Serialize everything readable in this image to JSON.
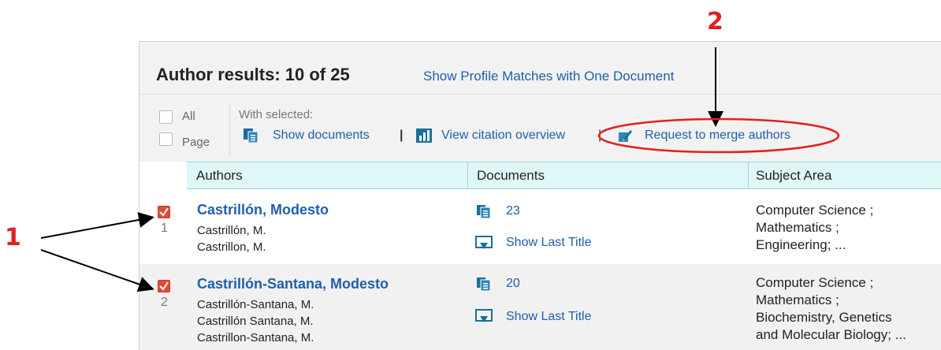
{
  "header": {
    "results_title": "Author results: 10 of 25",
    "profile_link": "Show Profile Matches with One Document"
  },
  "toolbar": {
    "select_all_label": "All",
    "select_page_label": "Page",
    "with_selected_label": "With selected:",
    "show_documents_label": "Show documents",
    "view_citation_label": "View citation overview",
    "request_merge_label": "Request to merge authors",
    "separator": "|"
  },
  "table": {
    "columns": [
      "Authors",
      "Documents",
      "Subject Area"
    ],
    "rows": [
      {
        "number": "1",
        "checked": true,
        "author": "Castrillón, Modesto",
        "variants": [
          "Castrillón, M.",
          "Castrillon, M."
        ],
        "documents": "23",
        "show_last_title": "Show Last Title",
        "subject_lines": [
          "Computer Science ;",
          "Mathematics ;",
          "Engineering; ..."
        ]
      },
      {
        "number": "2",
        "checked": true,
        "author": "Castrillón-Santana, Modesto",
        "variants": [
          "Castrillón-Santana, M.",
          "Castrillón Santana, M.",
          "Castrillon-Santana, M."
        ],
        "documents": "20",
        "show_last_title": "Show Last Title",
        "subject_lines": [
          "Computer Science ;",
          "Mathematics ;",
          "Biochemistry, Genetics",
          "and Molecular Biology; ..."
        ]
      }
    ]
  },
  "annotations": {
    "label_1": "1",
    "label_2": "2",
    "color": "#e02020"
  },
  "colors": {
    "link": "#1f5faa",
    "header_bg": "#f2f2f2",
    "table_header_bg": "#dff7f7",
    "checkbox_checked": "#e04a38"
  }
}
